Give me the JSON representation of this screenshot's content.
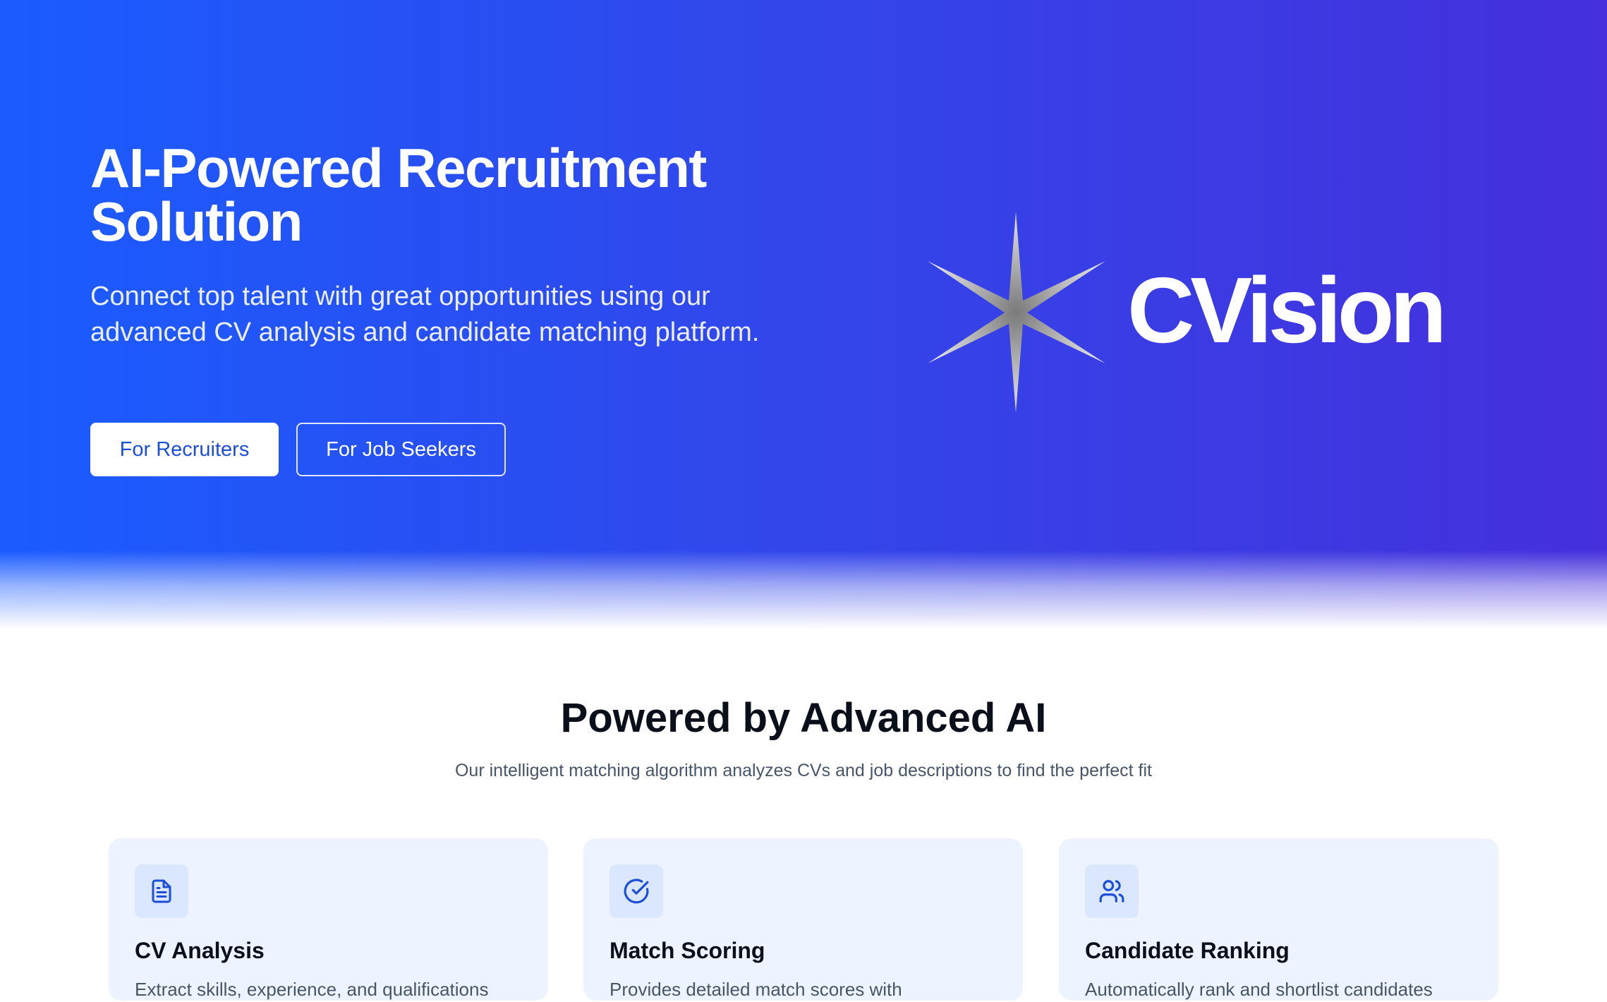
{
  "hero": {
    "title": "AI-Powered Recruitment Solution",
    "subtitle": "Connect top talent with great opportunities using our advanced CV analysis and candidate matching platform.",
    "primary_button": "For Recruiters",
    "secondary_button": "For Job Seekers",
    "brand_name": "CVision",
    "colors": {
      "gradient_start": "#1a5cff",
      "gradient_end": "#4530dc",
      "button_text": "#1d4ed8"
    }
  },
  "features": {
    "title": "Powered by Advanced AI",
    "subtitle": "Our intelligent matching algorithm analyzes CVs and job descriptions to find the perfect fit",
    "cards": [
      {
        "icon": "document-icon",
        "title": "CV Analysis",
        "description": "Extract skills, experience, and qualifications"
      },
      {
        "icon": "check-circle-icon",
        "title": "Match Scoring",
        "description": "Provides detailed match scores with"
      },
      {
        "icon": "users-icon",
        "title": "Candidate Ranking",
        "description": "Automatically rank and shortlist candidates"
      }
    ]
  }
}
